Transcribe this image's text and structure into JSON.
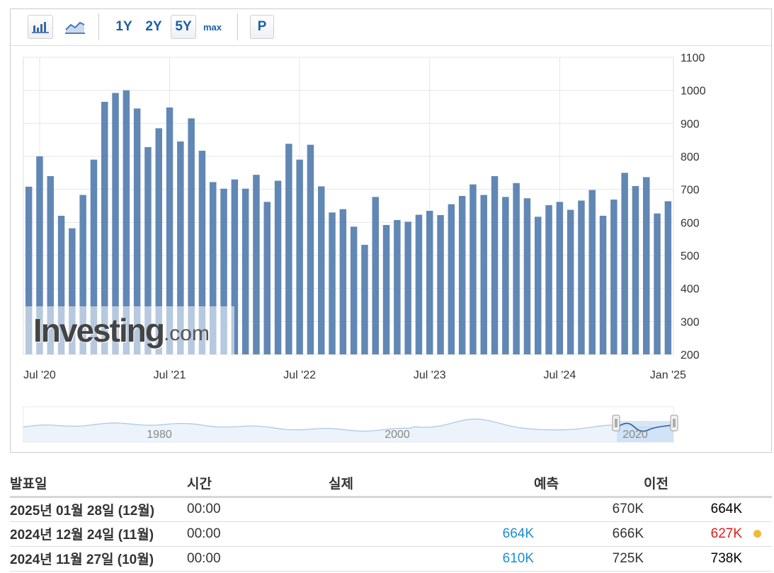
{
  "toolbar": {
    "icons": [
      "bar-chart-icon",
      "line-chart-icon"
    ],
    "ranges": [
      "1Y",
      "2Y",
      "5Y",
      "max"
    ],
    "active_range": "5Y",
    "p_label": "P"
  },
  "colors": {
    "bar": "#6187b5",
    "grid": "#e6e6e6",
    "nav_line": "#a9c6e8",
    "nav_fill": "#dce9f6"
  },
  "watermark": {
    "brand": "Investing",
    "domain": ".com"
  },
  "chart_data": {
    "type": "bar",
    "x_tick_labels": [
      "Jul '20",
      "Jul '21",
      "Jul '22",
      "Jul '23",
      "Jul '24",
      "Jan '25"
    ],
    "ylim": [
      200,
      1100
    ],
    "y_ticks": [
      200,
      300,
      400,
      500,
      600,
      700,
      800,
      900,
      1000,
      1100
    ],
    "grid": true,
    "values": [
      708,
      800,
      740,
      620,
      582,
      683,
      790,
      965,
      992,
      1000,
      945,
      828,
      885,
      948,
      845,
      915,
      817,
      722,
      702,
      730,
      702,
      744,
      662,
      726,
      838,
      790,
      835,
      709,
      630,
      640,
      587,
      532,
      677,
      592,
      607,
      602,
      623,
      635,
      622,
      655,
      680,
      715,
      683,
      740,
      677,
      719,
      673,
      617,
      652,
      662,
      638,
      666,
      698,
      620,
      669,
      750,
      710,
      737,
      627,
      664
    ],
    "navigator": {
      "labels": [
        "1980",
        "2000",
        "2020"
      ]
    }
  },
  "table": {
    "headers": [
      "발표일",
      "시간",
      "실제",
      "예측",
      "이전"
    ],
    "rows": [
      {
        "date": "2025년 01월 28일 (12월)",
        "time": "00:00",
        "actual": "",
        "forecast": "670K",
        "previous": "664K"
      },
      {
        "date": "2024년 12월 24일 (11월)",
        "time": "00:00",
        "actual": "664K",
        "forecast": "666K",
        "previous": "627K"
      },
      {
        "date": "2024년 11월 27일 (10월)",
        "time": "00:00",
        "actual": "610K",
        "forecast": "725K",
        "previous": "738K"
      }
    ]
  }
}
